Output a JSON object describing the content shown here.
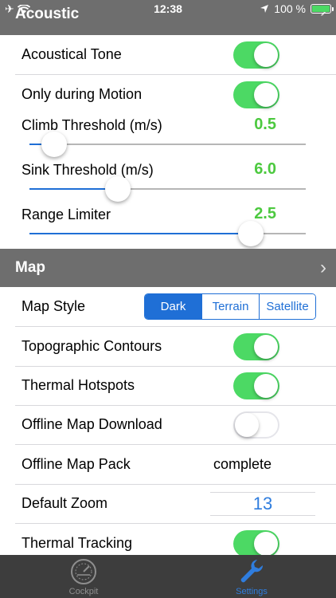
{
  "status": {
    "time": "12:38",
    "battery": "100 %",
    "airplane_icon": "airplane-icon",
    "wifi_icon": "wifi-icon",
    "location_icon": "location-arrow-icon"
  },
  "acoustic": {
    "header": "Acoustic",
    "acoustical_tone": "Acoustical Tone",
    "only_motion": "Only during Motion",
    "climb_label": "Climb Threshold (m/s)",
    "climb_value": "0.5",
    "climb_fraction": 0.09,
    "sink_label": "Sink Threshold (m/s)",
    "sink_value": "6.0",
    "sink_fraction": 0.32,
    "range_label": "Range Limiter",
    "range_value": "2.5",
    "range_fraction": 0.8
  },
  "map": {
    "header": "Map",
    "style_label": "Map Style",
    "style_options": [
      "Dark",
      "Terrain",
      "Satellite"
    ],
    "topo_label": "Topographic Contours",
    "hotspots_label": "Thermal Hotspots",
    "offline_download_label": "Offline Map Download",
    "offline_pack_label": "Offline Map Pack",
    "offline_pack_value": "complete",
    "zoom_label": "Default Zoom",
    "zoom_value": "13",
    "tracking_label": "Thermal Tracking"
  },
  "tabs": {
    "cockpit": "Cockpit",
    "settings": "Settings"
  },
  "colors": {
    "accent": "#1f6fd6",
    "toggle_on": "#4cd964",
    "value_green": "#4cc93f",
    "header_gray": "#6e6e6e"
  }
}
